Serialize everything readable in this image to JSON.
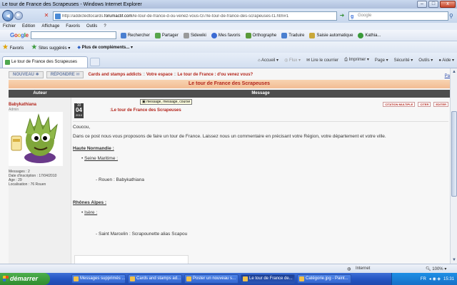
{
  "window": {
    "title": "Le tour de France des Scrapeuses - Windows Internet Explorer",
    "min": "–",
    "max": "□",
    "close": "x"
  },
  "nav": {
    "back": "◄",
    "forward": "►",
    "url_prefix": "http://addictedtocards.",
    "url_domain": "forumactif.com",
    "url_rest": "/le-tour-de-france-d-ou-venez-vous-t37/le-tour-de-france-des-scrapeuses-t1.htm#1",
    "search_placeholder": "Google"
  },
  "menu": [
    "Fichier",
    "Edition",
    "Affichage",
    "Favoris",
    "Outils",
    "?"
  ],
  "google_toolbar": {
    "logo": [
      "G",
      "o",
      "o",
      "g",
      "l",
      "e"
    ],
    "items": [
      "Rechercher",
      "Partager",
      "Sidewiki",
      "Mes favoris",
      "Orthographe",
      "Traduire",
      "Saisie automatique",
      "Kathia..."
    ]
  },
  "favbar": {
    "favoris": "Favoris",
    "sites": "Sites suggérés",
    "plus": "Plus de compléments..."
  },
  "tab": {
    "label": "Le tour de France des Scrapeuses"
  },
  "commands": [
    "Accueil",
    "Flux",
    "Lire le courrier",
    "Imprimer",
    "Page",
    "Sécurité",
    "Outils",
    "Aide"
  ],
  "forum": {
    "btn_new": "NOUVEAU",
    "btn_reply": "RÉPONDRE",
    "crumbs": [
      "Cards and stamps addicts",
      "Votre espace",
      "Le tour de France : d'ou venez vous?"
    ],
    "crumb_sep": "::",
    "pa": "Pa",
    "topic_title": "Le tour de France des Scrapeuses",
    "col_author": "Auteur",
    "col_message": "Message"
  },
  "author": {
    "name": "Babykathiana",
    "role": "Admin",
    "stats": [
      "Messages : 2",
      "Date d'inscription : 17/04/2010",
      "Age : 29",
      "Localisation : 76 Rouen"
    ]
  },
  "post": {
    "date_day_label": "10",
    "date_day": "04",
    "date_year": "2010",
    "title": "Le tour de France des Scrapeuses",
    "tooltip": "message, message, course",
    "actions": [
      "CITATION MULTIPLE",
      "CITER",
      "EDITER"
    ],
    "greeting": "Coucou,",
    "intro": "Dans ce post nous vous proposons de faire un tour de France. Laissez nous un commentaire en précisant votre Région, votre département et votre ville.",
    "regions": [
      {
        "region": "Haute Normandie :",
        "dept": "Seine Maritime :",
        "entry": "Rouen : Babykathiana"
      },
      {
        "region": "Rhônes Alpes :",
        "dept": "Isère :",
        "entry": "Saint Marcelin : Scrapounette alias Scapou"
      }
    ]
  },
  "status": {
    "zone": "Internet",
    "zoom": "100%"
  },
  "taskbar": {
    "start": "démarrer",
    "tasks": [
      "Messages supprimés ...",
      "Cards and stamps ad...",
      "Poster un nouveau s...",
      "Le tour de France de...",
      "Catégorie.jpg - Paint..."
    ],
    "lang": "FR",
    "clock": "15:31"
  }
}
